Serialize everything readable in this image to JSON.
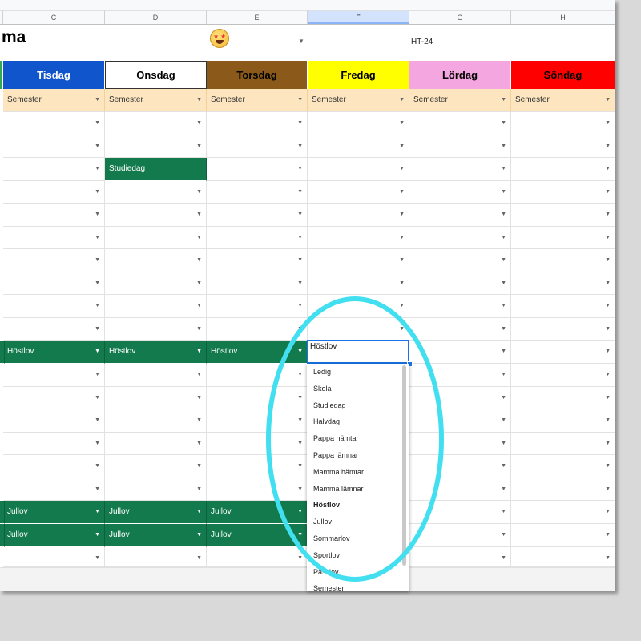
{
  "columns": {
    "c": "C",
    "d": "D",
    "e": "E",
    "f": "F",
    "g": "G",
    "h": "H"
  },
  "title": {
    "text": "ma",
    "emoji": "star-struck-emoji",
    "term": "HT-24"
  },
  "days": [
    {
      "label": "Tisdag",
      "bg": "#1155cc",
      "color": "#ffffff"
    },
    {
      "label": "Onsdag",
      "bg": "#ffffff",
      "color": "#000000"
    },
    {
      "label": "Torsdag",
      "bg": "#8b5a1a",
      "color": "#000000"
    },
    {
      "label": "Fredag",
      "bg": "#ffff00",
      "color": "#000000"
    },
    {
      "label": "Lördag",
      "bg": "#f4a6e0",
      "color": "#000000"
    },
    {
      "label": "Söndag",
      "bg": "#ff0000",
      "color": "#000000"
    }
  ],
  "semester_row": "Semester",
  "cells": {
    "studiedag": "Studiedag",
    "hostlov": "Höstlov",
    "jullov": "Jullov"
  },
  "editing_value": "Höstlov",
  "dropdown_options": [
    "Ledig",
    "Skola",
    "Studiedag",
    "Halvdag",
    "Pappa hämtar",
    "Pappa lämnar",
    "Mamma hämtar",
    "Mamma lämnar",
    "Höstlov",
    "Jullov",
    "Sommarlov",
    "Sportlov",
    "Påsklov",
    "Semester"
  ],
  "colors": {
    "status_green": "#137a4d",
    "semester_bg": "#fce5bf",
    "highlight": "#41dff0"
  }
}
